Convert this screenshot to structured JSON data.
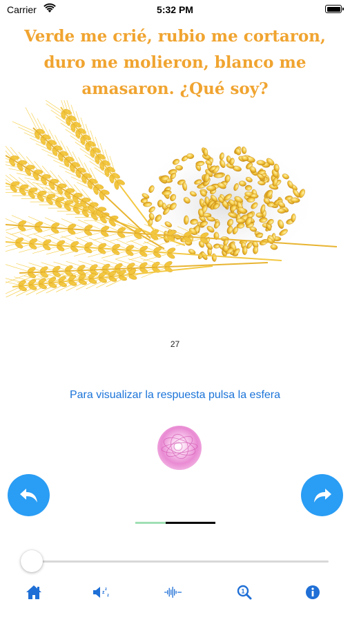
{
  "status": {
    "carrier": "Carrier",
    "time": "5:32 PM"
  },
  "riddle": {
    "line1": "Verde me crié, rubio me cortaron,",
    "line2": "duro me molieron, blanco me",
    "line3": "amasaron. ¿Qué soy?"
  },
  "counter": "27",
  "hint": "Para visualizar la respuesta pulsa la esfera",
  "progress_fraction": 0.38,
  "slider_value": 0.0,
  "colors": {
    "riddle_text": "#f0a430",
    "hint_text": "#1a73d9",
    "nav_button": "#2a9df4",
    "tab_icon": "#1f6fd6",
    "progress_played": "#9fe0b4",
    "progress_rest": "#000000"
  },
  "tabs": [
    {
      "icon": "home-icon"
    },
    {
      "icon": "speaker-sleep-icon"
    },
    {
      "icon": "waveform-icon"
    },
    {
      "icon": "zoom-icon"
    },
    {
      "icon": "info-icon"
    }
  ],
  "illustration": {
    "subject": "wheat ears and pile of grain"
  }
}
